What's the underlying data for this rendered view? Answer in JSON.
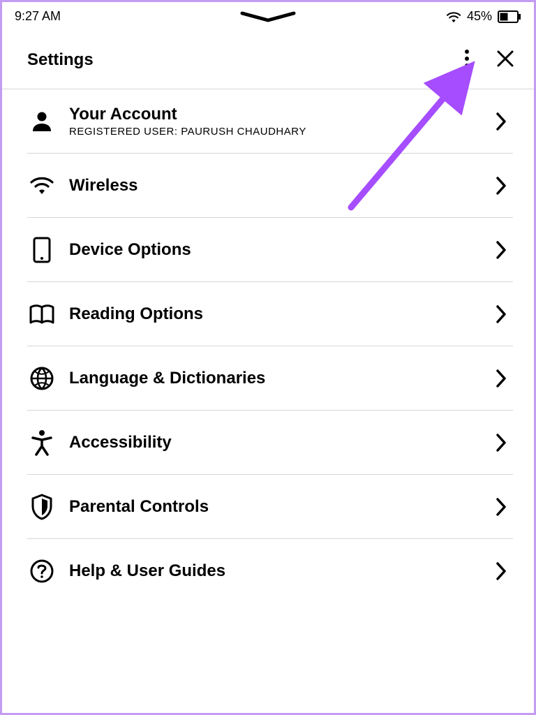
{
  "status": {
    "time": "9:27 AM",
    "battery_pct": "45%"
  },
  "header": {
    "title": "Settings"
  },
  "items": [
    {
      "label": "Your Account",
      "sub": "REGISTERED USER: PAURUSH CHAUDHARY"
    },
    {
      "label": "Wireless"
    },
    {
      "label": "Device Options"
    },
    {
      "label": "Reading Options"
    },
    {
      "label": "Language & Dictionaries"
    },
    {
      "label": "Accessibility"
    },
    {
      "label": "Parental Controls"
    },
    {
      "label": "Help & User Guides"
    }
  ],
  "annotation": {
    "arrow_color": "#a64dff"
  }
}
